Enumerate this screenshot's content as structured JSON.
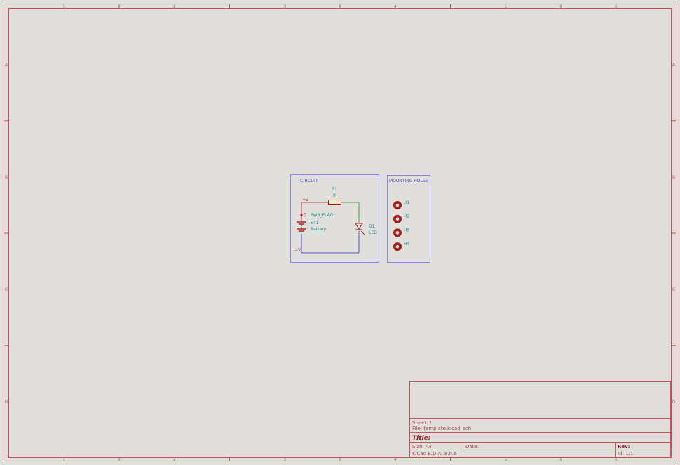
{
  "colors": {
    "background": "#e1dfdc",
    "frame": "#c4525a",
    "symbol": "#a81b1b",
    "ref_text": "#0f8a86",
    "net_label": "#8a1f1f",
    "wire_red": "#c4474f",
    "wire_green": "#3aa64a",
    "wire_blue": "#5052c8",
    "box_outline": "#8a87e0",
    "box_title": "#4443c0",
    "title_block_text": "#a64a4a"
  },
  "frame": {
    "columns": [
      "1",
      "2",
      "3",
      "4",
      "5",
      "6"
    ],
    "rows": [
      "A",
      "B",
      "C",
      "D"
    ]
  },
  "circuit_box": {
    "title": "CIRCUIT",
    "net_plus": "+V",
    "net_minus": "−V",
    "resistor": {
      "ref": "R1",
      "value": "R",
      "icon": "resistor-icon"
    },
    "battery": {
      "ref": "BT1",
      "value": "Battery",
      "icon": "battery-icon"
    },
    "power_flag": {
      "label": "PWR_FLAG",
      "pin": "0",
      "icon": "power-flag-icon"
    },
    "led": {
      "ref": "D1",
      "value": "LED",
      "icon": "led-icon"
    }
  },
  "mounting_box": {
    "title": "MOUNTING HOLES",
    "holes": [
      {
        "ref": "H1",
        "icon": "mounting-hole-icon"
      },
      {
        "ref": "H2",
        "icon": "mounting-hole-icon"
      },
      {
        "ref": "H3",
        "icon": "mounting-hole-icon"
      },
      {
        "ref": "H4",
        "icon": "mounting-hole-icon"
      }
    ]
  },
  "title_block": {
    "sheet": "Sheet: /",
    "file": "File: template.kicad_sch",
    "title": "Title:",
    "size": "Size: A4",
    "date": "Date:",
    "rev": "Rev:",
    "app": "KiCad E.D.A. 8.0.6",
    "id": "Id: 1/1"
  }
}
